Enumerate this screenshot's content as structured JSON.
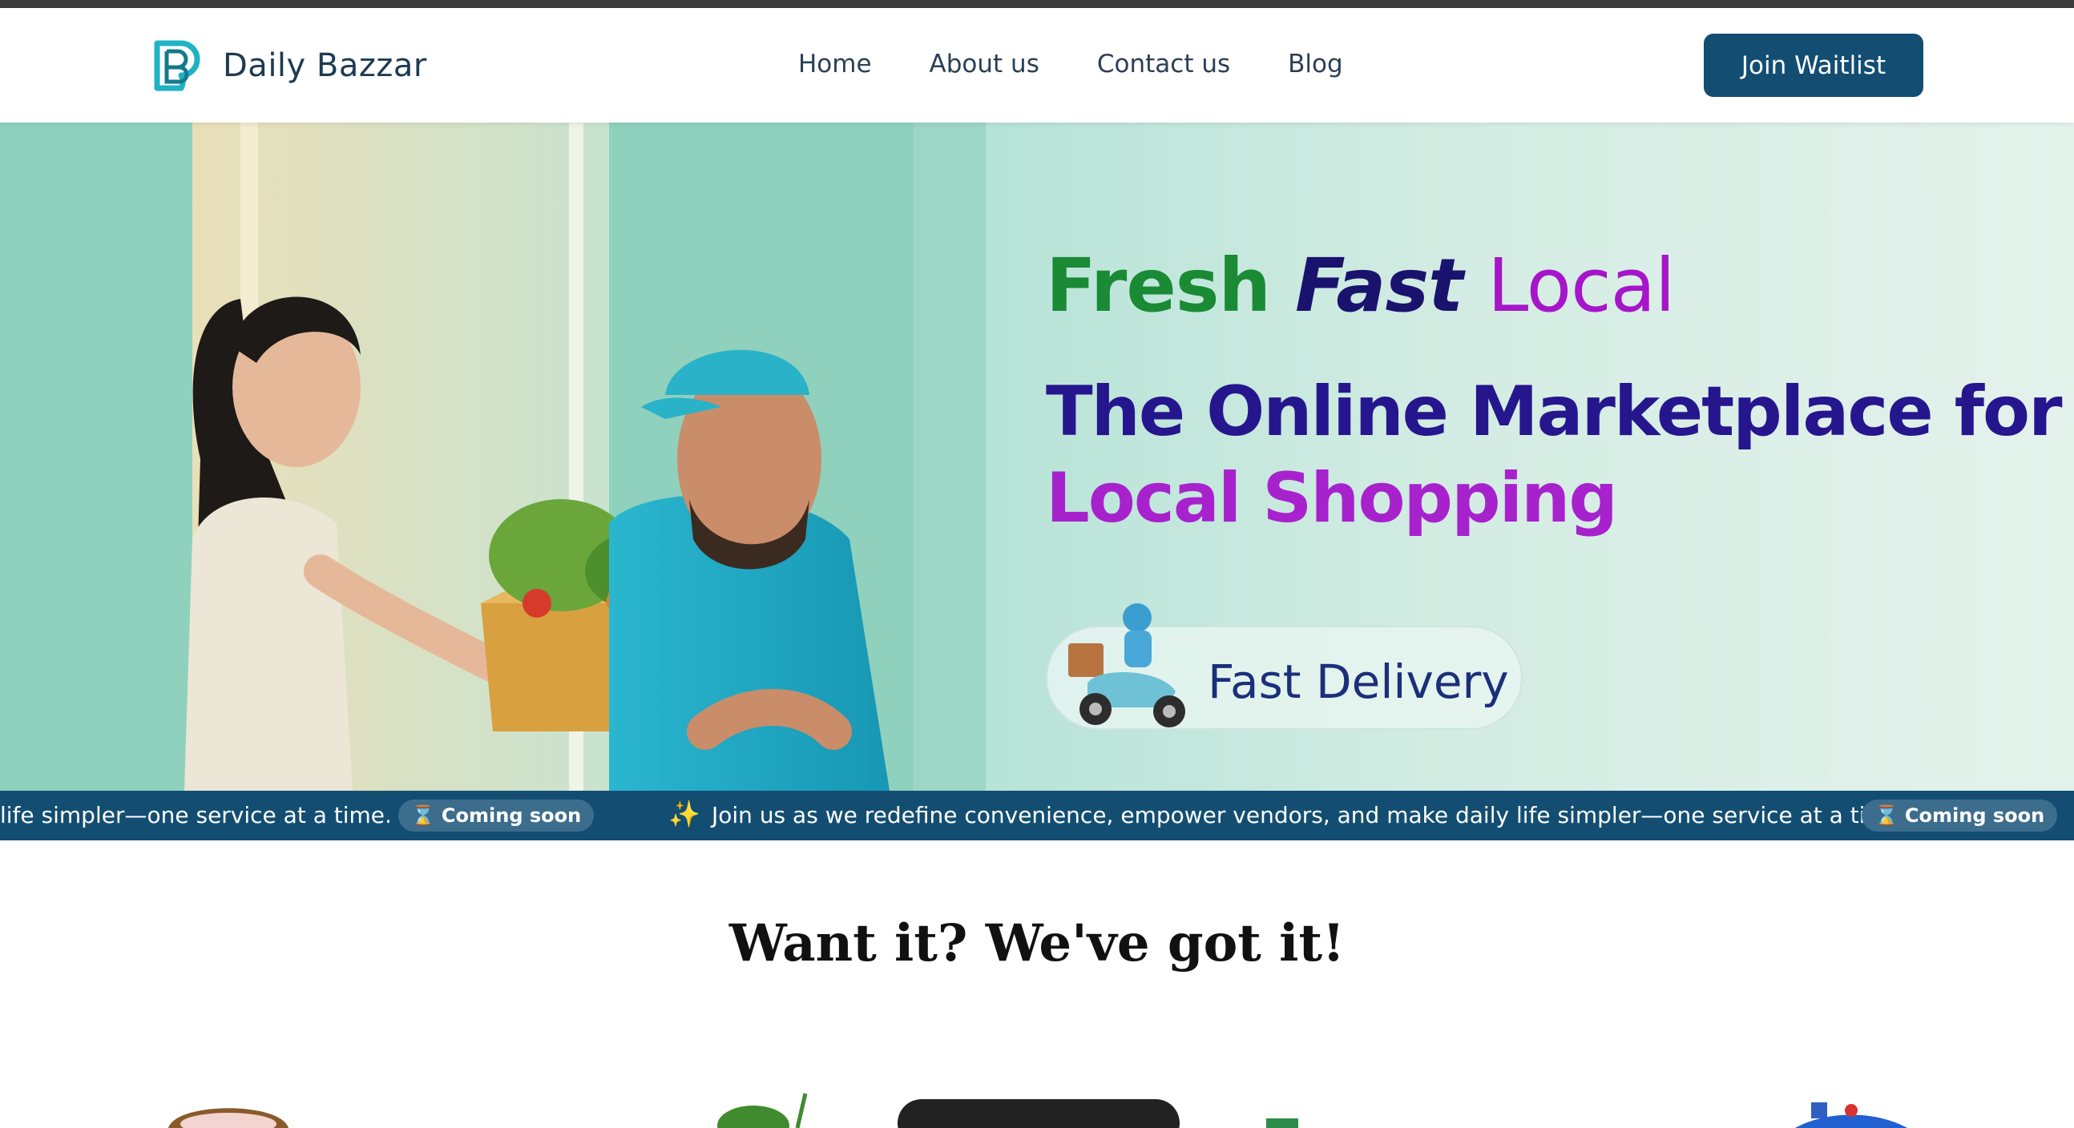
{
  "header": {
    "brand": "Daily Bazzar",
    "nav": [
      "Home",
      "About us",
      "Contact us",
      "Blog"
    ],
    "cta_label": "Join Waitlist"
  },
  "hero": {
    "tagline": {
      "w1": "Fresh",
      "w2": "Fast",
      "w3": "Local"
    },
    "headline": {
      "line1": "The Online Marketplace for",
      "line2": "Local Shopping"
    },
    "delivery_label": "Fast Delivery"
  },
  "ticker": {
    "message_partial": "life simpler—one service at a time.",
    "message": "Join us as we redefine convenience, empower vendors, and make daily life simpler—one service at a time.",
    "badge": "Coming soon",
    "badge_icon": "hourglass-icon",
    "sparkle_icon": "sparkles-icon"
  },
  "section": {
    "title": "Want it? We've got it!"
  },
  "colors": {
    "brand_dark": "#134e72",
    "fresh_green": "#1a8a35",
    "fast_navy": "#1a136e",
    "local_purple": "#a615c9"
  }
}
